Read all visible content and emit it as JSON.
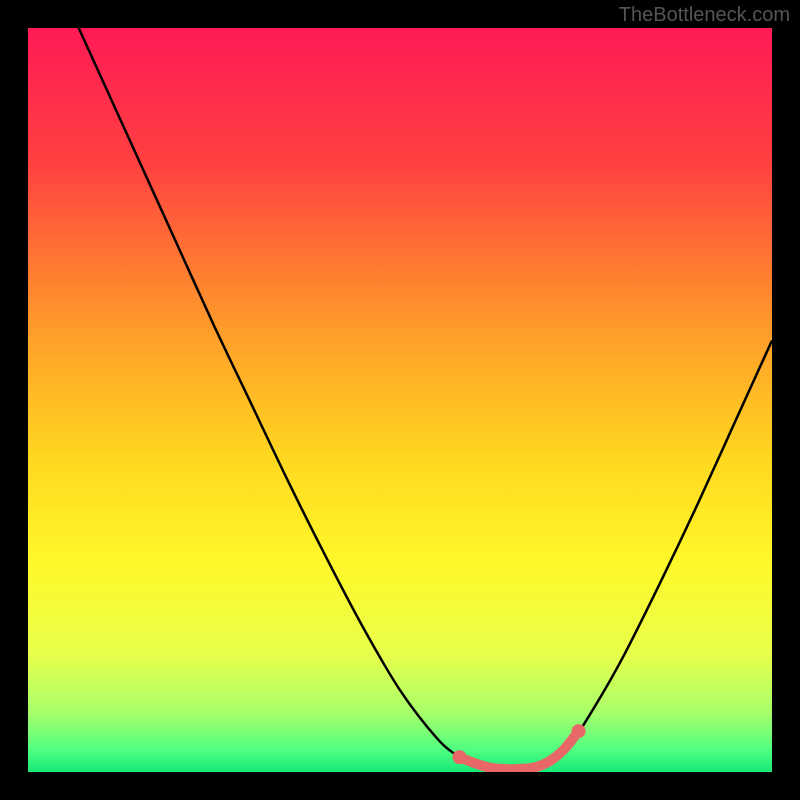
{
  "watermark": "TheBottleneck.com",
  "chart_data": {
    "type": "line",
    "title": "",
    "xlabel": "",
    "ylabel": "",
    "xlim": [
      0,
      100
    ],
    "ylim": [
      0,
      100
    ],
    "x_smooth": [
      0,
      5,
      10,
      15,
      20,
      25,
      30,
      35,
      40,
      45,
      50,
      55,
      58,
      60,
      62,
      65,
      68,
      70,
      73,
      76,
      80,
      85,
      90,
      95,
      100
    ],
    "y_smooth": [
      115,
      104,
      93,
      82,
      71,
      60,
      49.5,
      39,
      29,
      19.5,
      11,
      4.5,
      2,
      1,
      0.5,
      0.3,
      0.5,
      1.5,
      4,
      8.5,
      15.5,
      25.5,
      36,
      47,
      58
    ],
    "marker_x": [
      58,
      60,
      62,
      64,
      66,
      68,
      70,
      72,
      74
    ],
    "marker_y": [
      2,
      1.2,
      0.6,
      0.4,
      0.4,
      0.6,
      1.4,
      3,
      5.5
    ],
    "gradient_stops": [
      {
        "offset": 0,
        "color": "#ff1a56"
      },
      {
        "offset": 18,
        "color": "#ff4040"
      },
      {
        "offset": 40,
        "color": "#ff9a2a"
      },
      {
        "offset": 58,
        "color": "#ffd820"
      },
      {
        "offset": 72,
        "color": "#fff82a"
      },
      {
        "offset": 84,
        "color": "#e8ff4a"
      },
      {
        "offset": 92,
        "color": "#a8ff6a"
      },
      {
        "offset": 97,
        "color": "#50ff80"
      },
      {
        "offset": 100,
        "color": "#18e878"
      }
    ],
    "curve_color": "#000000",
    "marker_color": "#e86868"
  }
}
